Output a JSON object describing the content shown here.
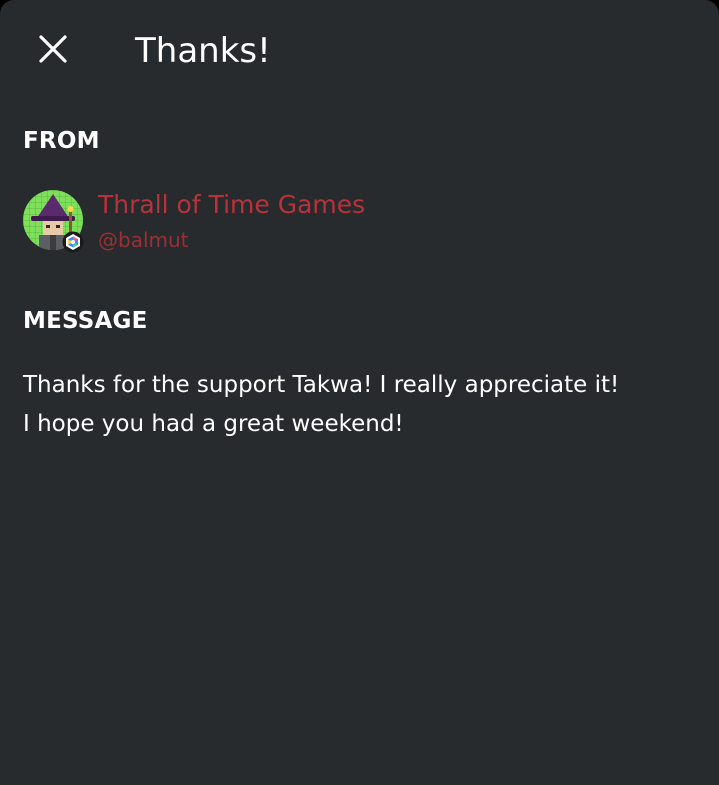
{
  "header": {
    "title": "Thanks!",
    "close_icon": "close-icon"
  },
  "from": {
    "label": "FROM",
    "sender": {
      "name": "Thrall of Time Games",
      "handle": "@balmut",
      "avatar_icon": "avatar-image",
      "badge_icon": "supporter-badge-icon"
    }
  },
  "message": {
    "label": "MESSAGE",
    "lines": [
      "Thanks for the support Takwa! I really appreciate it!",
      "I hope you had a great weekend!"
    ]
  },
  "colors": {
    "background": "#282b2d",
    "accent": "#b8323a",
    "text": "#ffffff"
  }
}
